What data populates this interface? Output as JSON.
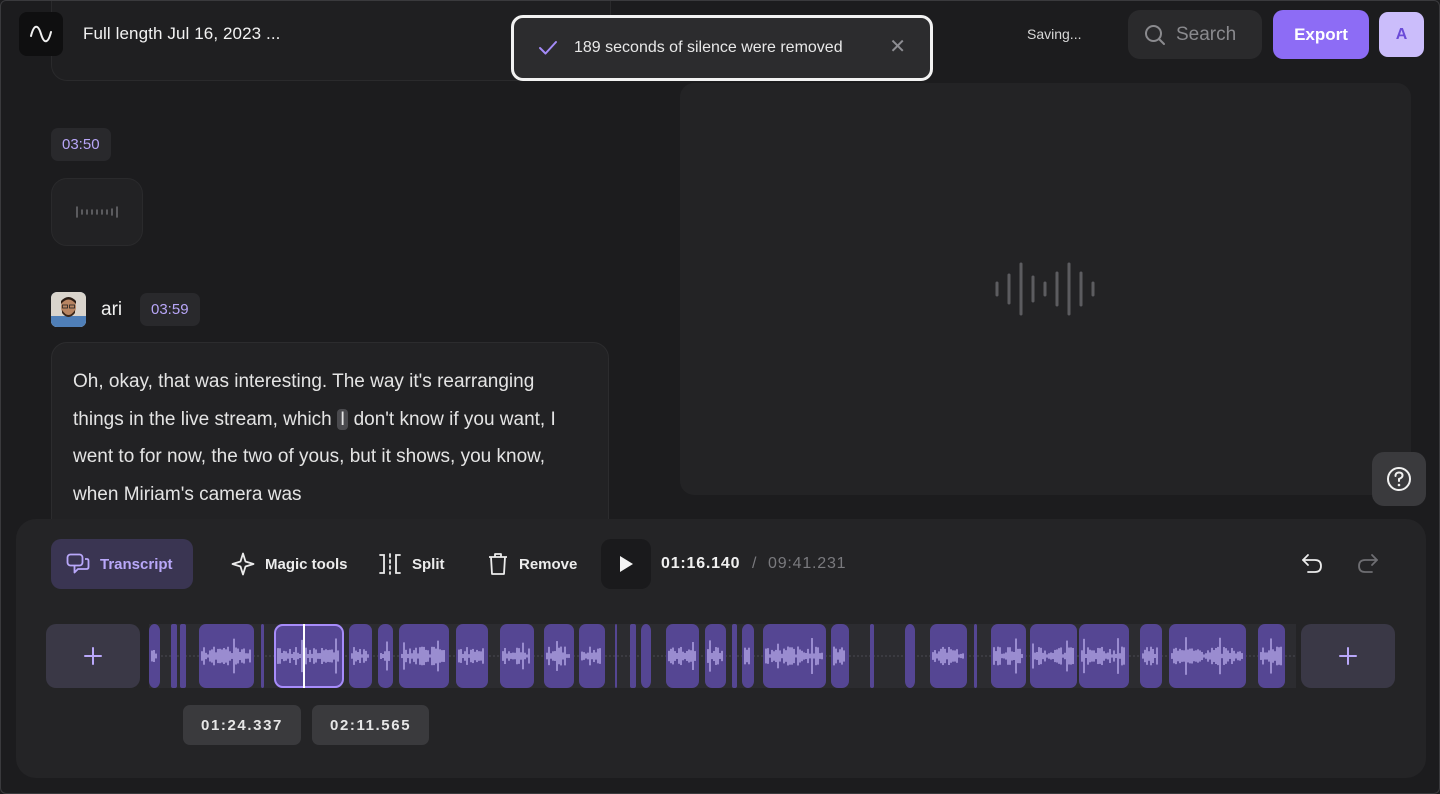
{
  "header": {
    "title": "Full length Jul 16, 2023 ...",
    "status": "Saving...",
    "search_label": "Search",
    "export_label": "Export",
    "user_initial": "A"
  },
  "toast": {
    "message": "189 seconds of silence were removed"
  },
  "transcript": {
    "silence_timestamp": "03:50",
    "speaker_name": "ari",
    "speaker_timestamp": "03:59",
    "text_before": "Oh, okay, that was interesting. The way it's rearranging things in the live stream, which ",
    "text_highlight": "I",
    "text_after": " don't know if you want, I went to for now, the two of yous, but it shows, you know, when Miriam's camera was"
  },
  "toolbar": {
    "transcript_label": "Transcript",
    "magic_label": "Magic tools",
    "split_label": "Split",
    "remove_label": "Remove",
    "current_time": "01:16.140",
    "separator": "/",
    "total_time": "09:41.231"
  },
  "timeline": {
    "selection_start": "01:24.337",
    "selection_end": "02:11.565"
  },
  "colors": {
    "accent": "#8d6cf5",
    "clip": "#554693",
    "timestamp_text": "#b8a6f8"
  }
}
